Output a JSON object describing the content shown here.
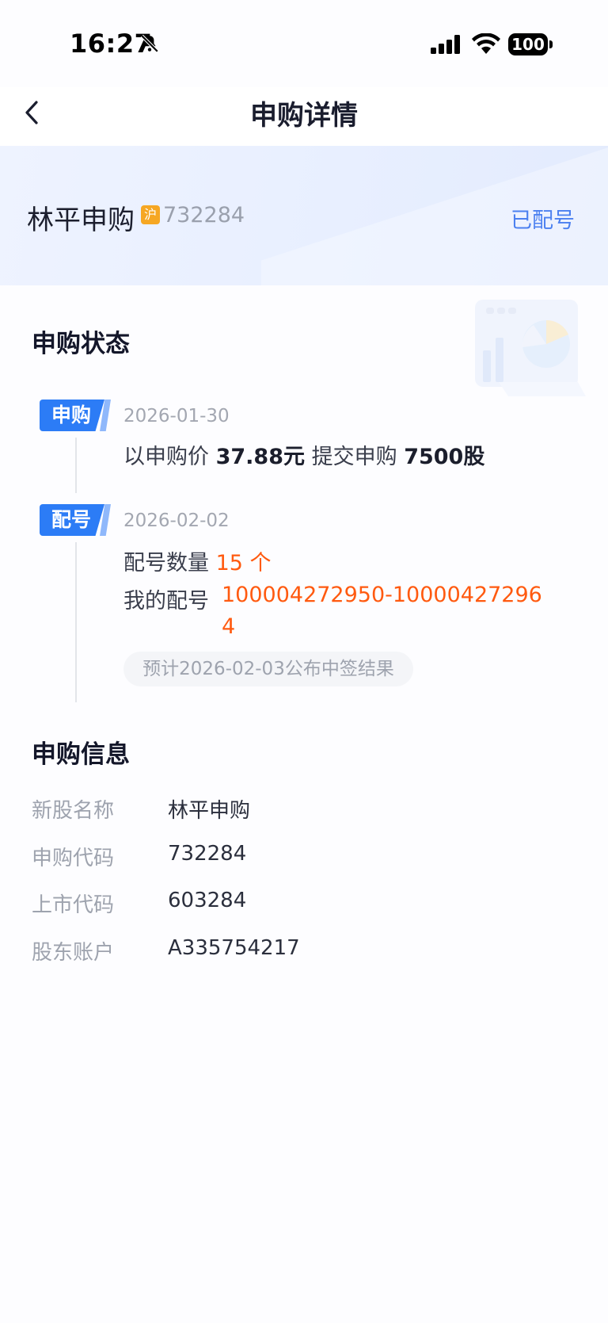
{
  "status_bar": {
    "time": "16:27",
    "battery": "100",
    "icons": [
      "bell-slash-icon",
      "cellular-signal-icon",
      "wifi-icon",
      "battery-icon"
    ]
  },
  "nav": {
    "title": "申购详情",
    "back_icon": "chevron-left-icon"
  },
  "stock": {
    "name": "林平申购",
    "market_badge": "沪",
    "code": "732284",
    "status": "已配号"
  },
  "status_section": {
    "title": "申购状态",
    "steps": [
      {
        "tag": "申购",
        "date": "2026-01-30",
        "prefix": "以申购价",
        "price": "37.88元",
        "middle": "提交申购",
        "shares": "7500股"
      },
      {
        "tag": "配号",
        "date": "2026-02-02",
        "count_label": "配号数量",
        "count_value": "15 个",
        "range_label": "我的配号",
        "range_value": "100004272950-100004272964",
        "note": "预计2026-02-03公布中签结果"
      }
    ]
  },
  "info_section": {
    "title": "申购信息",
    "rows": [
      {
        "label": "新股名称",
        "value": "林平申购"
      },
      {
        "label": "申购代码",
        "value": "732284"
      },
      {
        "label": "上市代码",
        "value": "603284"
      },
      {
        "label": "股东账户",
        "value": "A335754217"
      }
    ]
  },
  "colors": {
    "accent_blue": "#2c7cf6",
    "status_blue": "#4b80f0",
    "highlight_orange": "#ff5a10",
    "market_badge": "#f6a723"
  }
}
